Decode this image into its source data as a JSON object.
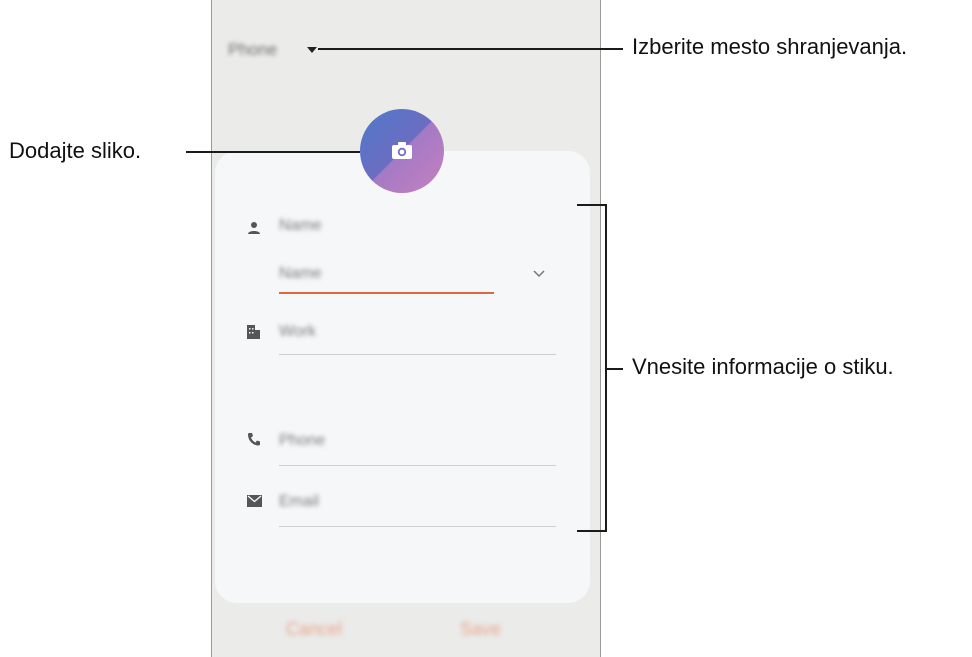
{
  "app": {
    "storage_selector": "Phone",
    "fields": {
      "name_placeholder": "Name",
      "name_sub_placeholder": "Name",
      "work_placeholder": "Work",
      "phone_placeholder": "Phone",
      "email_placeholder": "Email"
    },
    "buttons": {
      "cancel": "Cancel",
      "save": "Save"
    },
    "icons": {
      "avatar": "camera-icon",
      "name": "person-icon",
      "work": "building-icon",
      "phone": "phone-icon",
      "email": "mail-icon",
      "expand": "chevron-down-icon",
      "storage": "caret-down-icon"
    },
    "colors": {
      "background": "#ebebe9",
      "card": "#f6f7f8",
      "accent_underline": "#e0673e",
      "avatar_blue": "#4f79c8",
      "avatar_pink": "#c680c0"
    }
  },
  "annotations": {
    "storage": "Izberite mesto shranjevanja.",
    "picture": "Dodajte sliko.",
    "info": "Vnesite informacije o stiku."
  }
}
